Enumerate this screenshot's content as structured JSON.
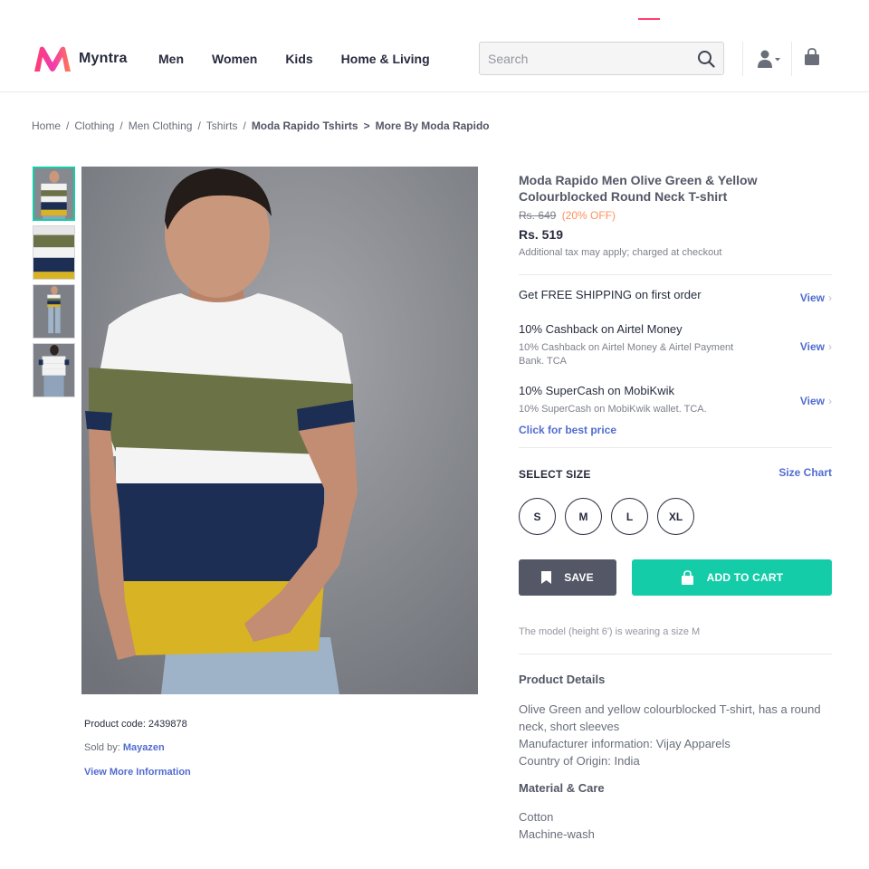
{
  "header": {
    "brand": "Myntra",
    "nav": [
      "Men",
      "Women",
      "Kids",
      "Home & Living"
    ],
    "search_placeholder": "Search",
    "accent_color": "#ff3f6c",
    "icons": [
      "myntra-logo",
      "search-icon",
      "profile-icon",
      "bag-icon"
    ]
  },
  "breadcrumb": {
    "items": [
      "Home",
      "Clothing",
      "Men Clothing",
      "Tshirts"
    ],
    "current": "Moda Rapido Tshirts",
    "arrow": ">",
    "last": "More By Moda Rapido"
  },
  "gallery": {
    "thumbnail_count": 4,
    "active_thumbnail": 1
  },
  "product_meta": {
    "code_label": "Product code: 2439878",
    "sold_by_label": "Sold by:",
    "seller": "Mayazen",
    "more_info": "View More Information"
  },
  "product": {
    "title": "Moda Rapido Men Olive Green & Yellow Colourblocked Round Neck T-shirt",
    "mrp": "Rs. 649",
    "discount": "(20% OFF)",
    "price": "Rs. 519",
    "tax_note": "Additional tax may apply; charged at checkout"
  },
  "offers": [
    {
      "title": "Get FREE SHIPPING on first order",
      "desc": "",
      "link": "View"
    },
    {
      "title": "10% Cashback on Airtel Money",
      "desc": "10% Cashback on Airtel Money & Airtel Payment Bank. TCA",
      "link": "View"
    },
    {
      "title": "10% SuperCash on MobiKwik",
      "desc": "10% SuperCash on MobiKwik wallet. TCA.",
      "link": "View"
    }
  ],
  "best_price": "Click for best price",
  "size": {
    "label": "SELECT SIZE",
    "chart": "Size Chart",
    "options": [
      "S",
      "M",
      "L",
      "XL"
    ]
  },
  "actions": {
    "save": "SAVE",
    "add_to_cart": "ADD TO CART",
    "save_color": "#535766",
    "cart_color": "#14cda8"
  },
  "model_note": "The model (height 6') is wearing a size M",
  "details": {
    "heading": "Product Details",
    "lines": [
      "Olive Green and yellow colourblocked T-shirt, has a round neck, short sleeves",
      "Manufacturer information: Vijay Apparels",
      "Country of Origin: India"
    ]
  },
  "material": {
    "heading": "Material & Care",
    "lines": [
      "Cotton",
      "Machine-wash"
    ]
  },
  "link_color": "#526cd0"
}
